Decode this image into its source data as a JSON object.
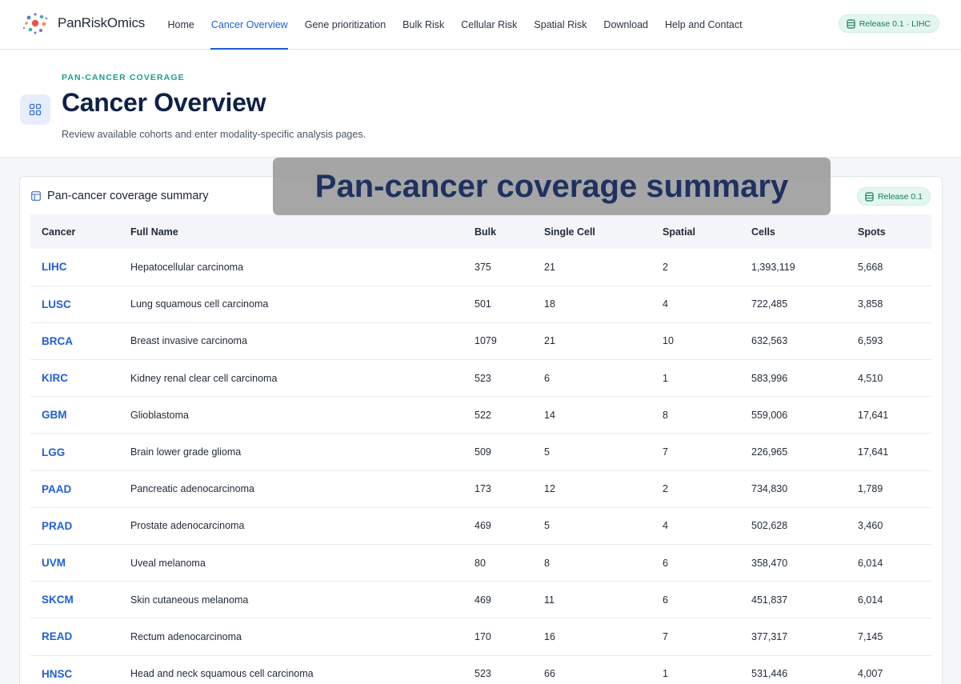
{
  "brand": {
    "name": "PanRiskOmics"
  },
  "nav": {
    "items": [
      {
        "label": "Home",
        "active": false
      },
      {
        "label": "Cancer Overview",
        "active": true
      },
      {
        "label": "Gene prioritization",
        "active": false
      },
      {
        "label": "Bulk Risk",
        "active": false
      },
      {
        "label": "Cellular Risk",
        "active": false
      },
      {
        "label": "Spatial Risk",
        "active": false
      },
      {
        "label": "Download",
        "active": false
      },
      {
        "label": "Help and Contact",
        "active": false
      }
    ],
    "release_label": "Release 0.1 · LIHC"
  },
  "header": {
    "eyebrow": "PAN-CANCER COVERAGE",
    "title": "Cancer Overview",
    "subtitle": "Review available cohorts and enter modality-specific analysis pages."
  },
  "card": {
    "title": "Pan-cancer coverage summary",
    "release_label": "Release 0.1"
  },
  "banner": {
    "text": "Pan-cancer coverage summary"
  },
  "table": {
    "columns": [
      "Cancer",
      "Full Name",
      "Bulk",
      "Single Cell",
      "Spatial",
      "Cells",
      "Spots"
    ],
    "rows": [
      {
        "cancer": "LIHC",
        "full_name": "Hepatocellular carcinoma",
        "bulk": "375",
        "single_cell": "21",
        "spatial": "2",
        "cells": "1,393,119",
        "spots": "5,668"
      },
      {
        "cancer": "LUSC",
        "full_name": "Lung squamous cell carcinoma",
        "bulk": "501",
        "single_cell": "18",
        "spatial": "4",
        "cells": "722,485",
        "spots": "3,858"
      },
      {
        "cancer": "BRCA",
        "full_name": "Breast invasive carcinoma",
        "bulk": "1079",
        "single_cell": "21",
        "spatial": "10",
        "cells": "632,563",
        "spots": "6,593"
      },
      {
        "cancer": "KIRC",
        "full_name": "Kidney renal clear cell carcinoma",
        "bulk": "523",
        "single_cell": "6",
        "spatial": "1",
        "cells": "583,996",
        "spots": "4,510"
      },
      {
        "cancer": "GBM",
        "full_name": "Glioblastoma",
        "bulk": "522",
        "single_cell": "14",
        "spatial": "8",
        "cells": "559,006",
        "spots": "17,641"
      },
      {
        "cancer": "LGG",
        "full_name": "Brain lower grade glioma",
        "bulk": "509",
        "single_cell": "5",
        "spatial": "7",
        "cells": "226,965",
        "spots": "17,641"
      },
      {
        "cancer": "PAAD",
        "full_name": "Pancreatic adenocarcinoma",
        "bulk": "173",
        "single_cell": "12",
        "spatial": "2",
        "cells": "734,830",
        "spots": "1,789"
      },
      {
        "cancer": "PRAD",
        "full_name": "Prostate adenocarcinoma",
        "bulk": "469",
        "single_cell": "5",
        "spatial": "4",
        "cells": "502,628",
        "spots": "3,460"
      },
      {
        "cancer": "UVM",
        "full_name": "Uveal melanoma",
        "bulk": "80",
        "single_cell": "8",
        "spatial": "6",
        "cells": "358,470",
        "spots": "6,014"
      },
      {
        "cancer": "SKCM",
        "full_name": "Skin cutaneous melanoma",
        "bulk": "469",
        "single_cell": "11",
        "spatial": "6",
        "cells": "451,837",
        "spots": "6,014"
      },
      {
        "cancer": "READ",
        "full_name": "Rectum adenocarcinoma",
        "bulk": "170",
        "single_cell": "16",
        "spatial": "7",
        "cells": "377,317",
        "spots": "7,145"
      },
      {
        "cancer": "HNSC",
        "full_name": "Head and neck squamous cell carcinoma",
        "bulk": "523",
        "single_cell": "66",
        "spatial": "1",
        "cells": "531,446",
        "spots": "4,007"
      }
    ]
  },
  "colors": {
    "accent": "#1f5fd6",
    "eyebrow": "#1aa091",
    "title": "#0f2147",
    "pill_bg": "#e3f6ef",
    "pill_text": "#167a5a"
  },
  "icons": {
    "logo": "molecule-logo-icon",
    "release": "database-icon",
    "header": "grid-icon",
    "card_title": "table-icon"
  }
}
